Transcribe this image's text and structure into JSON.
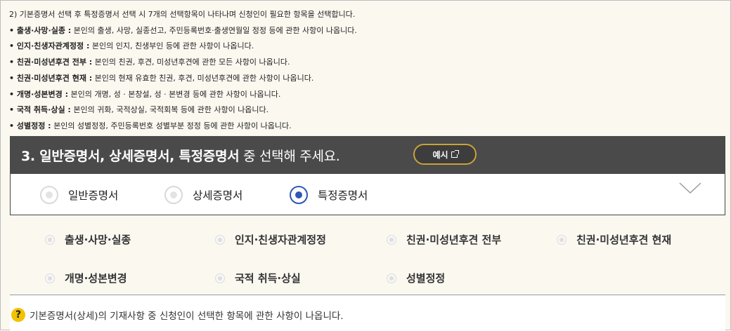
{
  "notes": {
    "intro": "2) 기본증명서 선택 후 특정증명서 선택 시 7개의 선택항목이 나타나며 신청인이 필요한 항목을 선택합니다.",
    "bullets": [
      {
        "term": "• 출생·사망·실종 :",
        "desc": " 본인의 출생, 사망, 실종선고, 주민등록번호·출생연월일 정정 등에 관한 사항이 나옵니다."
      },
      {
        "term": "• 인지·친생자관계정정 :",
        "desc": " 본인의 인지, 친생부인 등에 관한 사항이 나옵니다."
      },
      {
        "term": "• 친권·미성년후견 전부 :",
        "desc": " 본인의 친권, 후견, 미성년후견에 관한 모든 사항이 나옵니다."
      },
      {
        "term": "• 친권·미성년후견 현재 :",
        "desc": " 본인의 현재 유효한 친권, 후견, 미성년후견에 관한 사항이 나옵니다."
      },
      {
        "term": "• 개명·성본변경 :",
        "desc": " 본인의 개명, 성 · 본창설, 성 · 본변경 등에 관한 사항이 나옵니다."
      },
      {
        "term": "• 국적 취득·상실 :",
        "desc": " 본인의 귀화, 국적상실, 국적회복 등에 관한 사항이 나옵니다."
      },
      {
        "term": "• 성별정정 :",
        "desc": " 본인의 성별정정, 주민등록번호 성별부분 정정 등에 관한 사항이 나옵니다."
      }
    ]
  },
  "header": {
    "title_bold": "3. 일반증명서, 상세증명서, 특정증명서",
    "title_rest": " 중 선택해 주세요.",
    "example_label": "예시",
    "accent": "#c9a23a"
  },
  "selector": {
    "options": [
      {
        "label": "일반증명서",
        "selected": false
      },
      {
        "label": "상세증명서",
        "selected": false
      },
      {
        "label": "특정증명서",
        "selected": true
      }
    ],
    "selected_color": "#2e57b8",
    "expand_icon": "chevron-down-icon"
  },
  "items": [
    "출생·사망·실종",
    "인지·친생자관계정정",
    "친권·미성년후견 전부",
    "친권·미성년후견 현재",
    "개명·성본변경",
    "국적 취득·상실",
    "성별정정"
  ],
  "hint": {
    "icon": "?",
    "text": "기본증명서(상세)의 기재사항 중 신청인이 선택한 항목에 관한 사항이 나옵니다."
  }
}
